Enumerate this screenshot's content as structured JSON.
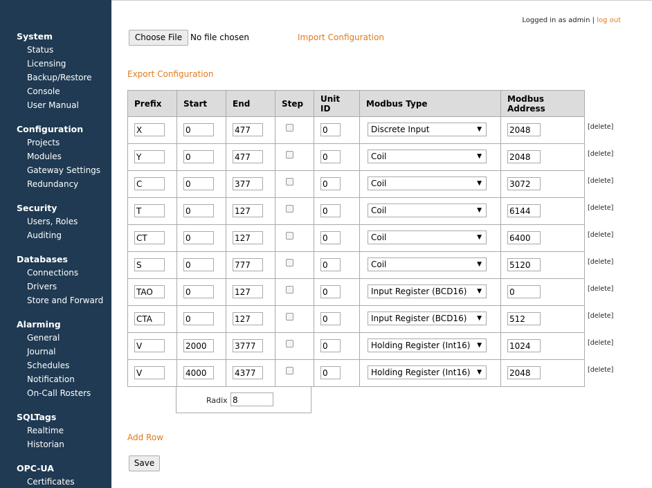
{
  "sidebar": {
    "sections": [
      {
        "title": "System",
        "items": [
          "Status",
          "Licensing",
          "Backup/Restore",
          "Console",
          "User Manual"
        ]
      },
      {
        "title": "Configuration",
        "items": [
          "Projects",
          "Modules",
          "Gateway Settings",
          "Redundancy"
        ]
      },
      {
        "title": "Security",
        "items": [
          "Users, Roles",
          "Auditing"
        ]
      },
      {
        "title": "Databases",
        "items": [
          "Connections",
          "Drivers",
          "Store and Forward"
        ]
      },
      {
        "title": "Alarming",
        "items": [
          "General",
          "Journal",
          "Schedules",
          "Notification",
          "On-Call Rosters"
        ]
      },
      {
        "title": "SQLTags",
        "items": [
          "Realtime",
          "Historian"
        ]
      },
      {
        "title": "OPC-UA",
        "items": [
          "Certificates"
        ]
      }
    ]
  },
  "header": {
    "logged_in_text": "Logged in as admin",
    "separator": "|",
    "logout_label": "log out"
  },
  "file": {
    "choose_label": "Choose File",
    "status": "No file chosen",
    "import_label": "Import Configuration"
  },
  "export_label": "Export Configuration",
  "table": {
    "headers": [
      "Prefix",
      "Start",
      "End",
      "Step",
      "Unit\nID",
      "Modbus Type",
      "Modbus\nAddress"
    ],
    "rows": [
      {
        "prefix": "X",
        "start": "0",
        "end": "477",
        "unit": "0",
        "type": "Discrete Input",
        "address": "2048"
      },
      {
        "prefix": "Y",
        "start": "0",
        "end": "477",
        "unit": "0",
        "type": "Coil",
        "address": "2048"
      },
      {
        "prefix": "C",
        "start": "0",
        "end": "377",
        "unit": "0",
        "type": "Coil",
        "address": "3072"
      },
      {
        "prefix": "T",
        "start": "0",
        "end": "127",
        "unit": "0",
        "type": "Coil",
        "address": "6144"
      },
      {
        "prefix": "CT",
        "start": "0",
        "end": "127",
        "unit": "0",
        "type": "Coil",
        "address": "6400"
      },
      {
        "prefix": "S",
        "start": "0",
        "end": "777",
        "unit": "0",
        "type": "Coil",
        "address": "5120"
      },
      {
        "prefix": "TAO",
        "start": "0",
        "end": "127",
        "unit": "0",
        "type": "Input Register (BCD16)",
        "address": "0"
      },
      {
        "prefix": "CTA",
        "start": "0",
        "end": "127",
        "unit": "0",
        "type": "Input Register (BCD16)",
        "address": "512"
      },
      {
        "prefix": "V",
        "start": "2000",
        "end": "3777",
        "unit": "0",
        "type": "Holding Register (Int16)",
        "address": "1024"
      },
      {
        "prefix": "V",
        "start": "4000",
        "end": "4377",
        "unit": "0",
        "type": "Holding Register (Int16)",
        "address": "2048"
      }
    ],
    "delete_label": "[delete]"
  },
  "radix": {
    "label": "Radix",
    "value": "8"
  },
  "add_row_label": "Add Row",
  "save_label": "Save",
  "colors": {
    "sidebar_bg": "#1f3a52",
    "link": "#e07a1c",
    "header_bg": "#dcdcdc"
  }
}
